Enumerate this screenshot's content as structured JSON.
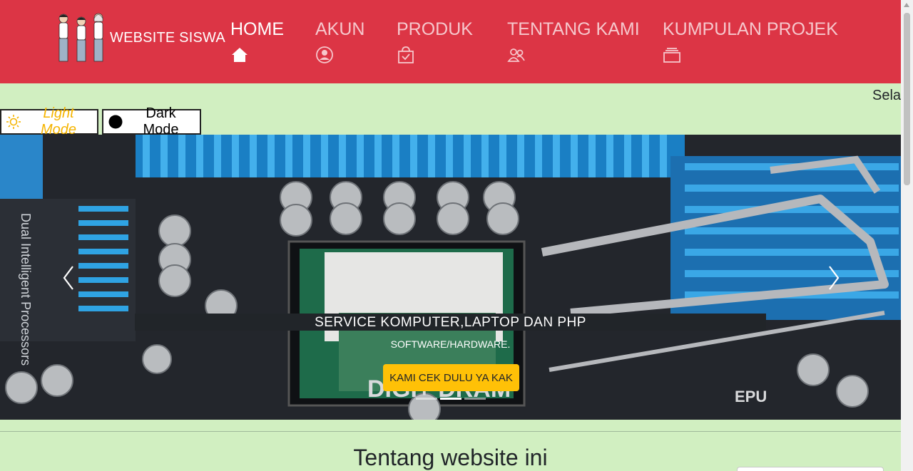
{
  "brand": {
    "name": "WEBSITE SISWA",
    "logo_icon": "students-logo"
  },
  "nav": [
    {
      "label": "HOME",
      "icon": "home-icon",
      "active": true
    },
    {
      "label": "AKUN",
      "icon": "user-circle-icon",
      "active": false
    },
    {
      "label": "PRODUK",
      "icon": "bag-check-icon",
      "active": false
    },
    {
      "label": "TENTANG KAMI",
      "icon": "people-icon",
      "active": false
    },
    {
      "label": "KUMPULAN PROJEK",
      "icon": "collection-icon",
      "active": false
    }
  ],
  "marquee": {
    "text": "Selar"
  },
  "modes": {
    "light_label": "Light Mode",
    "dark_label": "Dark Mode"
  },
  "carousel": {
    "caption_title": "SERVICE KOMPUTER,LAPTOP DAN PHP",
    "caption_sub": "SOFTWARE/HARDWARE.",
    "cta_label": "KAMI CEK DULU YA KAK",
    "active_slide": 1,
    "slide_count": 3
  },
  "section": {
    "title": "Tentang website ini"
  },
  "colors": {
    "navbar": "#dc3545",
    "page_bg": "#d1efc1",
    "cta": "#ffc107",
    "light_mode_text": "#f5b400"
  }
}
